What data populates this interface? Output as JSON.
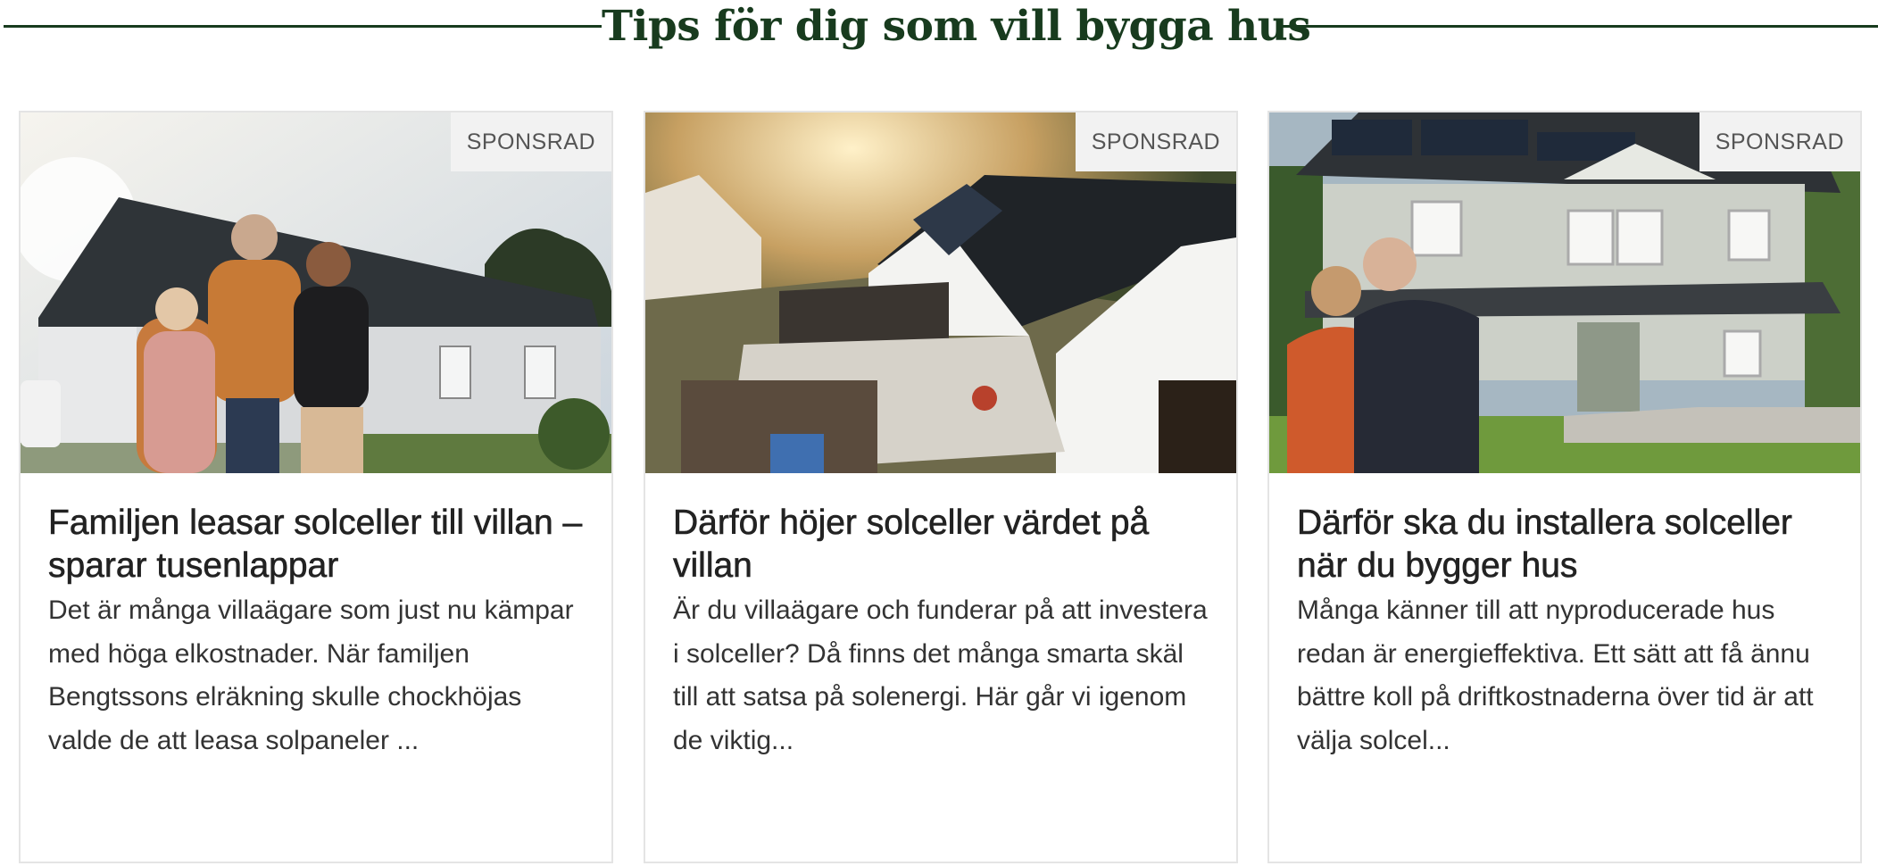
{
  "section": {
    "title": "Tips för dig som vill bygga hus"
  },
  "cards": [
    {
      "badge": "SPONSRAD",
      "image_alt": "Family standing in front of a white villa with solar panels",
      "title": "Familjen leasar solceller till villan – sparar tusenlappar",
      "excerpt": "Det är många villaägare som just nu kämpar med höga elkostnader. När familjen Bengtssons elräkning skulle chockhöjas valde de att leasa solpaneler ..."
    },
    {
      "badge": "SPONSRAD",
      "image_alt": "Aerial view of a modern house with black solar roof and patio at sunset",
      "title": "Därför höjer solceller värdet på villan",
      "excerpt": "Är du villaägare och funderar på att investera i solceller? Då finns det många smarta skäl till att satsa på solenergi. Här går vi igenom de viktig..."
    },
    {
      "badge": "SPONSRAD",
      "image_alt": "Couple in front of a two-storey grey house with solar panels",
      "title": "Därför ska du installera solceller när du bygger hus",
      "excerpt": "Många känner till att nyproducerade hus redan är energieffektiva. Ett sätt att få ännu bättre koll på driftkostnaderna över tid är att välja solcel..."
    }
  ]
}
